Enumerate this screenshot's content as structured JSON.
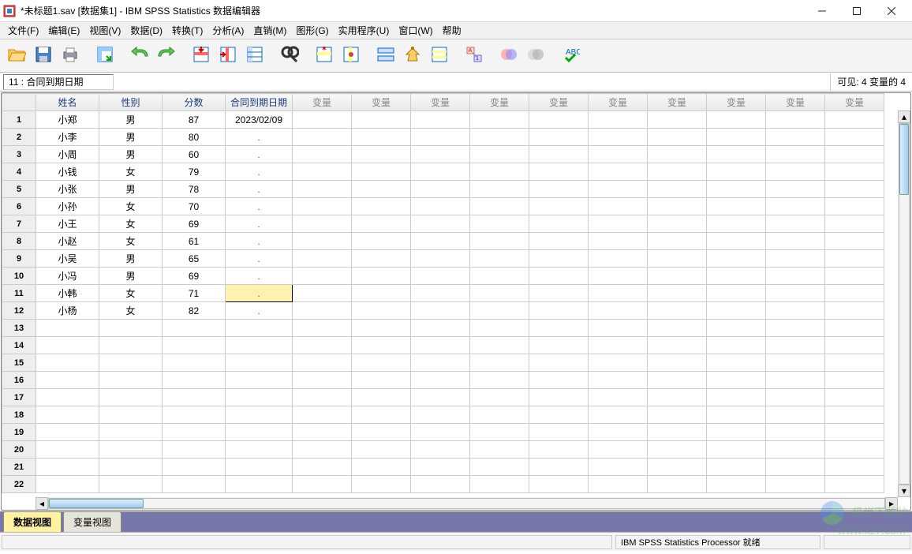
{
  "titlebar": {
    "title": "*未标题1.sav [数据集1] - IBM SPSS Statistics 数据编辑器"
  },
  "menubar": {
    "items": [
      {
        "label": "文件(F)",
        "key": "F"
      },
      {
        "label": "编辑(E)",
        "key": "E"
      },
      {
        "label": "视图(V)",
        "key": "V"
      },
      {
        "label": "数据(D)",
        "key": "D"
      },
      {
        "label": "转换(T)",
        "key": "T"
      },
      {
        "label": "分析(A)",
        "key": "A"
      },
      {
        "label": "直销(M)",
        "key": "M"
      },
      {
        "label": "图形(G)",
        "key": "G"
      },
      {
        "label": "实用程序(U)",
        "key": "U"
      },
      {
        "label": "窗口(W)",
        "key": "W"
      },
      {
        "label": "帮助"
      }
    ]
  },
  "cellref": {
    "address": "11 : 合同到期日期",
    "visible_label": "可见: 4 变量的 4"
  },
  "columns": {
    "defined": [
      "姓名",
      "性别",
      "分数",
      "合同到期日期"
    ],
    "placeholder": "变量",
    "placeholder_count": 10
  },
  "rows": [
    {
      "n": 1,
      "cells": [
        "小郑",
        "男",
        "87",
        "2023/02/09"
      ]
    },
    {
      "n": 2,
      "cells": [
        "小李",
        "男",
        "80",
        "."
      ]
    },
    {
      "n": 3,
      "cells": [
        "小周",
        "男",
        "60",
        "."
      ]
    },
    {
      "n": 4,
      "cells": [
        "小钱",
        "女",
        "79",
        "."
      ]
    },
    {
      "n": 5,
      "cells": [
        "小张",
        "男",
        "78",
        "."
      ]
    },
    {
      "n": 6,
      "cells": [
        "小孙",
        "女",
        "70",
        "."
      ]
    },
    {
      "n": 7,
      "cells": [
        "小王",
        "女",
        "69",
        "."
      ]
    },
    {
      "n": 8,
      "cells": [
        "小赵",
        "女",
        "61",
        "."
      ]
    },
    {
      "n": 9,
      "cells": [
        "小吴",
        "男",
        "65",
        "."
      ]
    },
    {
      "n": 10,
      "cells": [
        "小冯",
        "男",
        "69",
        "."
      ]
    },
    {
      "n": 11,
      "cells": [
        "小韩",
        "女",
        "71",
        "."
      ],
      "selected_col": 3
    },
    {
      "n": 12,
      "cells": [
        "小杨",
        "女",
        "82",
        "."
      ]
    }
  ],
  "blank_rows": [
    13,
    14,
    15,
    16,
    17,
    18,
    19,
    20,
    21,
    22
  ],
  "views": {
    "data": "数据视图",
    "variable": "变量视图",
    "active": "data"
  },
  "statusbar": {
    "processor": "IBM SPSS Statistics Processor 就绪"
  },
  "watermark": {
    "name": "极光下载站",
    "url": "www.xz7.com"
  },
  "toolbar_icons": [
    "open",
    "save",
    "print",
    "",
    "pivot",
    "",
    "undo",
    "redo",
    "",
    "goto-case",
    "goto-var",
    "variables",
    "",
    "find",
    "",
    "insert-case",
    "insert-var",
    "",
    "split",
    "weight",
    "select",
    "",
    "value-labels",
    "",
    "sets",
    "sets-off",
    "",
    "spellcheck"
  ],
  "col_widths": {
    "row": 43,
    "name": 80,
    "sex": 80,
    "score": 80,
    "date": 85,
    "var": 75
  }
}
